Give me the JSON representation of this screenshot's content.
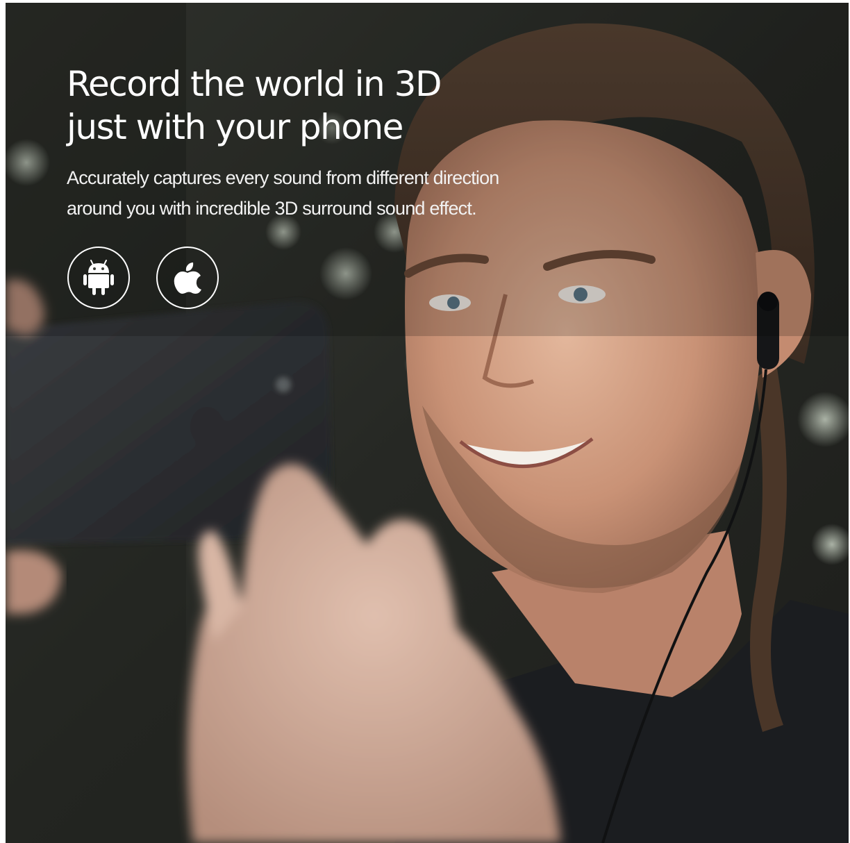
{
  "hero": {
    "headline_line1": "Record the world in 3D",
    "headline_line2": "just with your phone",
    "subline_line1": "Accurately captures every sound from different direction",
    "subline_line2": "around you with incredible 3D surround sound effect."
  },
  "badges": [
    {
      "icon": "android-icon"
    },
    {
      "icon": "apple-icon"
    }
  ],
  "colors": {
    "text": "#ffffff",
    "badge_ring": "#ffffff",
    "background_dark": "#2e302c"
  }
}
